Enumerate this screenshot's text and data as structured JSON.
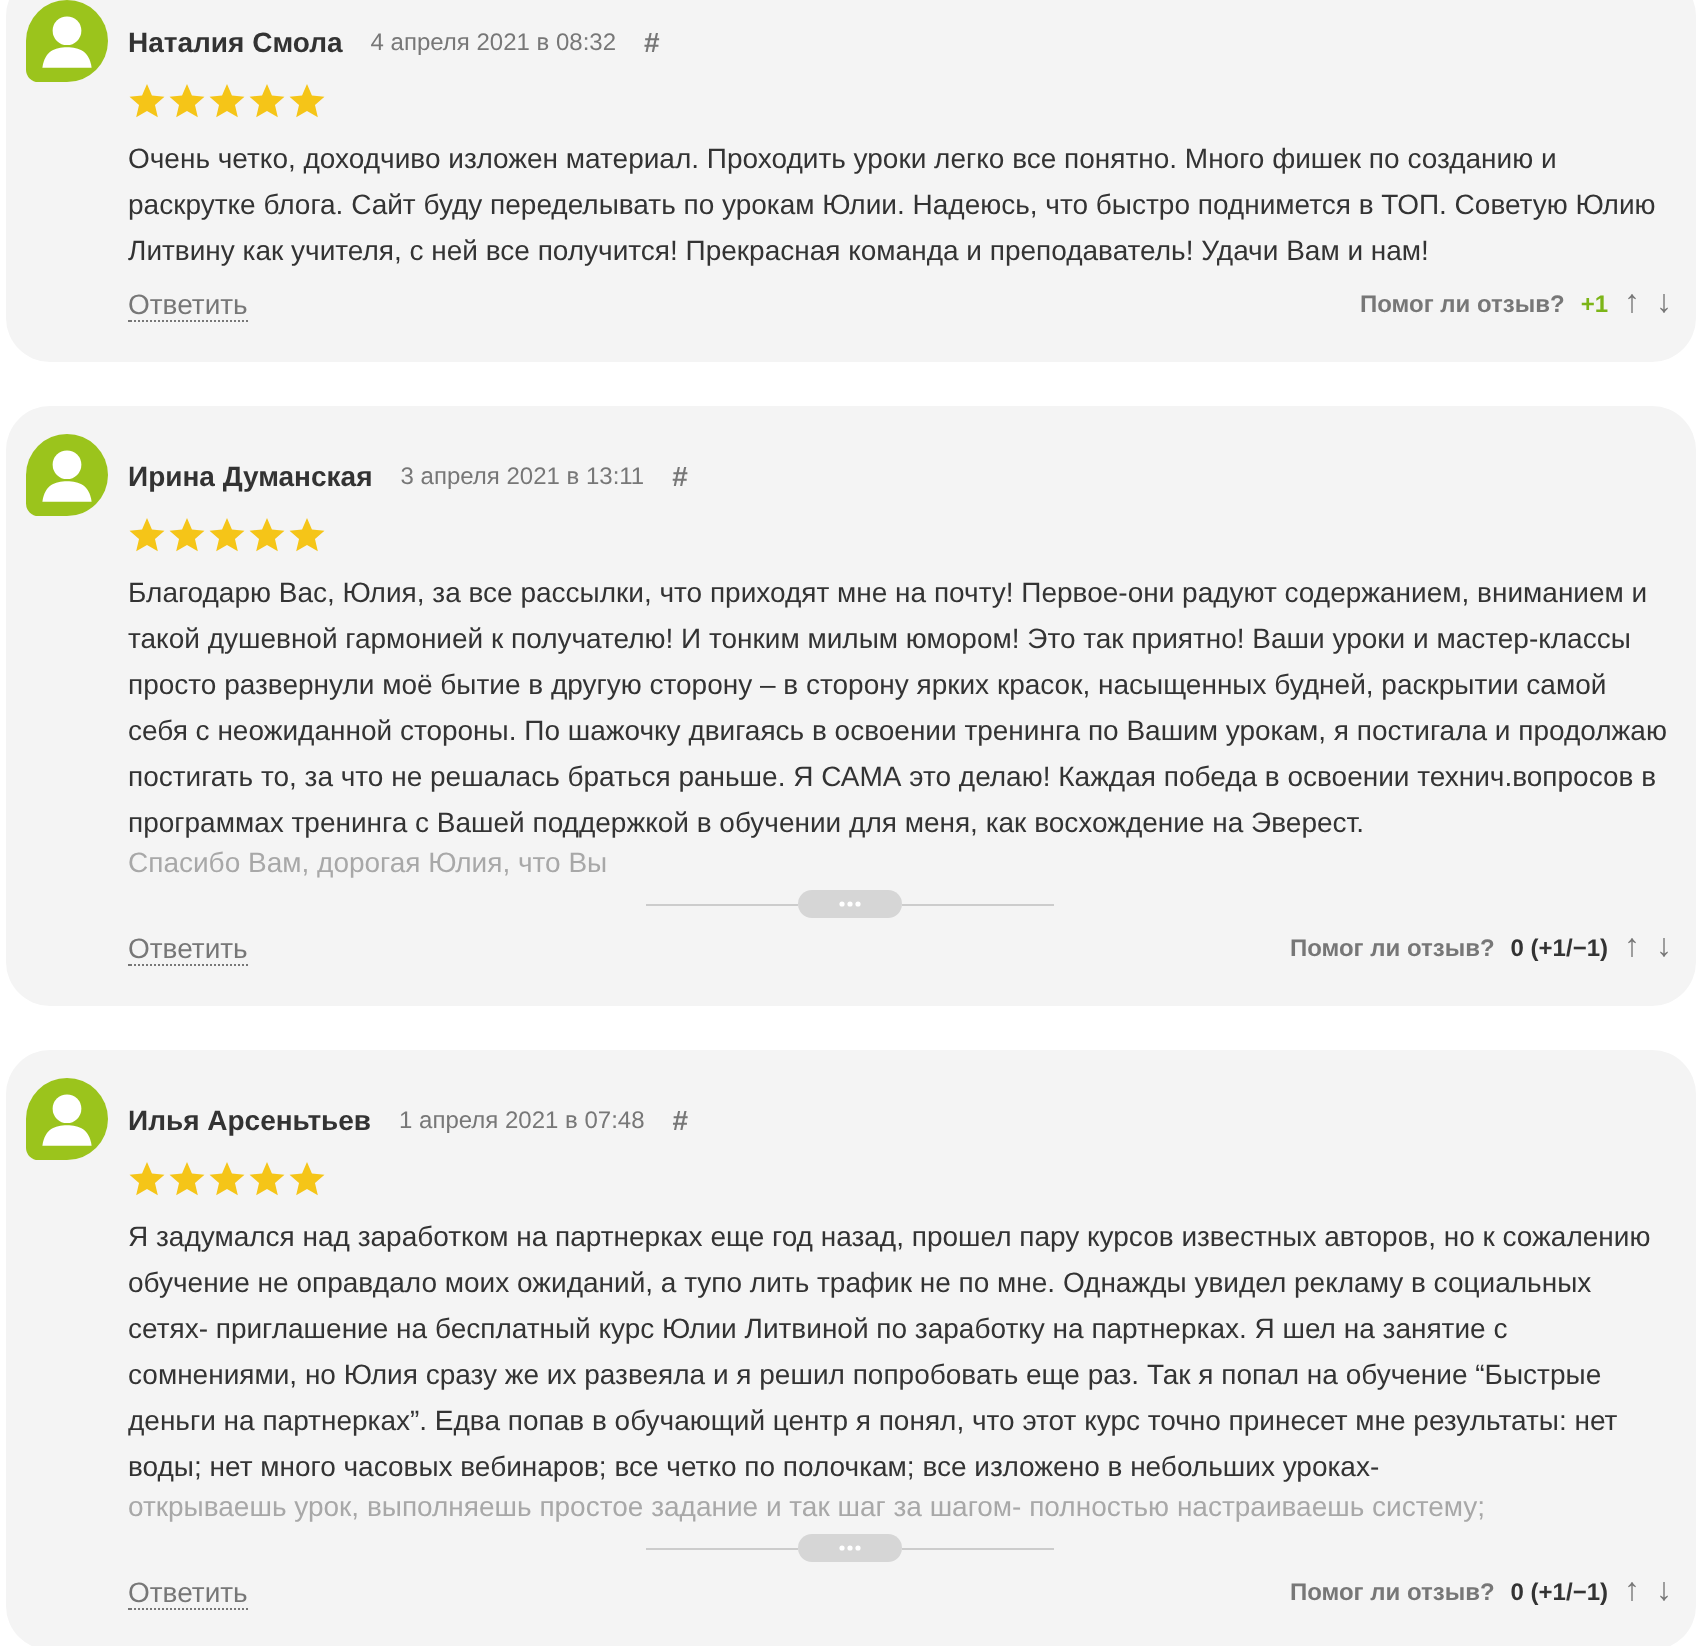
{
  "reviews": [
    {
      "author": "Наталия Смола",
      "date": "4 апреля 2021 в 08:32",
      "anchor": "#",
      "stars": 5,
      "text": "Очень четко, доходчиво изложен материал. Проходить уроки легко все понятно. Много фишек по созданию и раскрутке блога. Сайт буду переделывать по урокам Юлии. Надеюсь, что быстро поднимется в ТОП. Советую Юлию Литвину как учителя, с ней все получится! Прекрасная команда и преподаватель! Удачи Вам и нам!",
      "collapsed": false,
      "reply": "Ответить",
      "helpful_label": "Помог ли отзыв?",
      "score": "+1",
      "highlighted": true,
      "up": "↑",
      "down": "↓"
    },
    {
      "author": "Ирина Думанская",
      "date": "3 апреля 2021 в 13:11",
      "anchor": "#",
      "stars": 5,
      "text": "Благодарю Вас, Юлия, за все рассылки, что приходят мне на почту! Первое-они радуют содержанием, вниманием и такой душевной гармонией к получателю! И тонким милым юмором! Это так приятно! Ваши уроки и мастер-классы просто развернули моё бытие в другую сторону – в сторону ярких красок, насыщенных будней, раскрытии самой себя с неожиданной стороны. По шажочку двигаясь в освоении тренинга по Вашим урокам, я постигала и продолжаю постигать то, за что не решалась браться раньше. Я САМА это делаю! Каждая победа в освоении технич.вопросов в программах тренинга с Вашей поддержкой в обучении для меня, как восхождение на Эверест.",
      "faded": "Спасибо Вам, дорогая Юлия, что Вы",
      "collapsed": true,
      "reply": "Ответить",
      "helpful_label": "Помог ли отзыв?",
      "score": "0 (+1/−1)",
      "highlighted": false,
      "up": "↑",
      "down": "↓"
    },
    {
      "author": "Илья Арсеньтьев",
      "date": "1 апреля 2021 в 07:48",
      "anchor": "#",
      "stars": 5,
      "text": "Я задумался над заработком на партнерках еще год назад, прошел пару курсов известных авторов, но к сожалению обучение не оправдало моих ожиданий, а тупо лить трафик не по мне. Однажды увидел рекламу в социальных сетях- приглашение на бесплатный курс Юлии Литвиной по заработку на партнерках. Я шел на занятие с сомнениями, но Юлия сразу же их развеяла и я решил попробовать еще раз. Так я попал на обучение “Быстрые деньги на партнерках”. Едва попав в обучающий центр я понял, что этот курс точно принесет мне результаты: нет воды; нет много часовых вебинаров; все четко по полочкам; все изложено в небольших уроках-",
      "faded": "открываешь урок, выполняешь простое задание и так шаг за шагом- полностью настраиваешь систему;",
      "collapsed": true,
      "reply": "Ответить",
      "helpful_label": "Помог ли отзыв?",
      "score": "0 (+1/−1)",
      "highlighted": false,
      "up": "↑",
      "down": "↓"
    }
  ]
}
